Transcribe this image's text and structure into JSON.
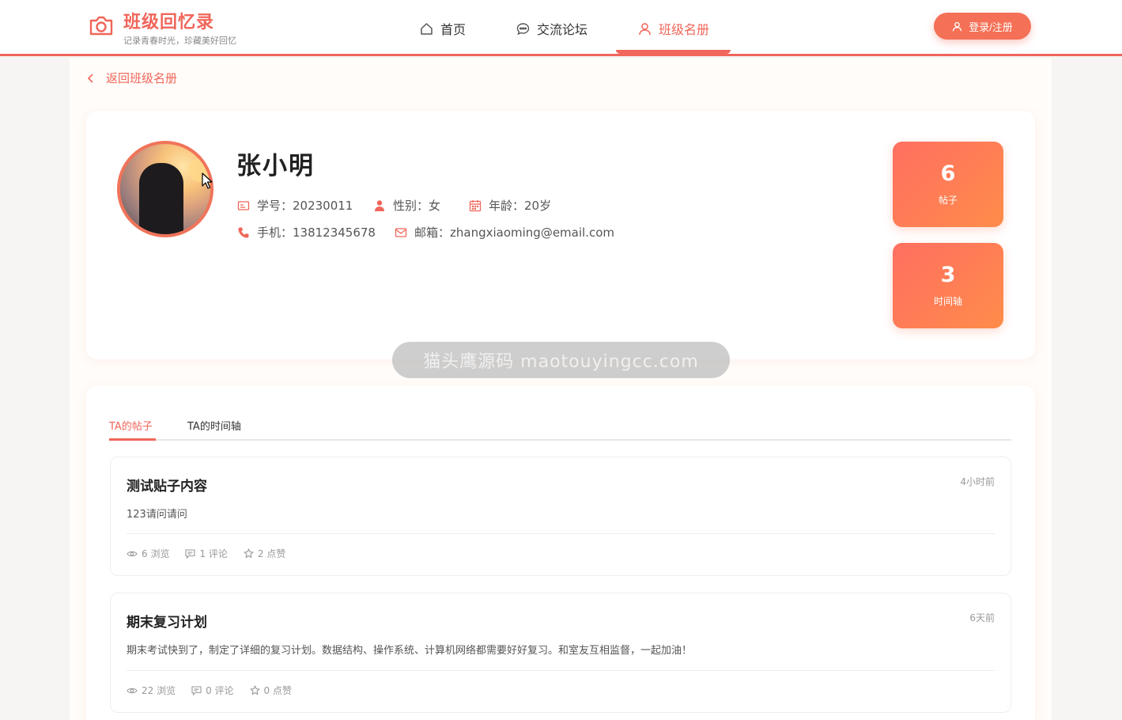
{
  "brand": {
    "title": "班级回忆录",
    "subtitle": "记录青春时光，珍藏美好回忆"
  },
  "nav": [
    {
      "label": "首页",
      "icon": "home-icon"
    },
    {
      "label": "交流论坛",
      "icon": "chat-icon"
    },
    {
      "label": "班级名册",
      "icon": "user-icon",
      "active": true
    }
  ],
  "login_label": "登录/注册",
  "back_label": "返回班级名册",
  "profile": {
    "name": "张小明",
    "student_id": "学号：20230011",
    "gender": "性别：女",
    "age": "年龄：20岁",
    "phone": "手机：13812345678",
    "email": "邮箱：zhangxiaoming@email.com"
  },
  "stats": [
    {
      "num": "6",
      "label": "帖子"
    },
    {
      "num": "3",
      "label": "时间轴"
    }
  ],
  "watermark": "猫头鹰源码 maotouyingcc.com",
  "tabs": [
    {
      "label": "TA的帖子",
      "active": true
    },
    {
      "label": "TA的时间轴",
      "active": false
    }
  ],
  "posts": [
    {
      "title": "测试贴子内容",
      "time": "4小时前",
      "body": "123请问请问",
      "views": "6 浏览",
      "comments": "1 评论",
      "likes": "2 点赞"
    },
    {
      "title": "期末复习计划",
      "time": "6天前",
      "body": "期末考试快到了，制定了详细的复习计划。数据结构、操作系统、计算机网络都需要好好复习。和室友互相监督，一起加油！",
      "views": "22 浏览",
      "comments": "0 评论",
      "likes": "0 点赞"
    }
  ],
  "colors": {
    "accent": "#f0665a",
    "gradient_start": "#ff6f61",
    "gradient_end": "#ff8c4a"
  }
}
